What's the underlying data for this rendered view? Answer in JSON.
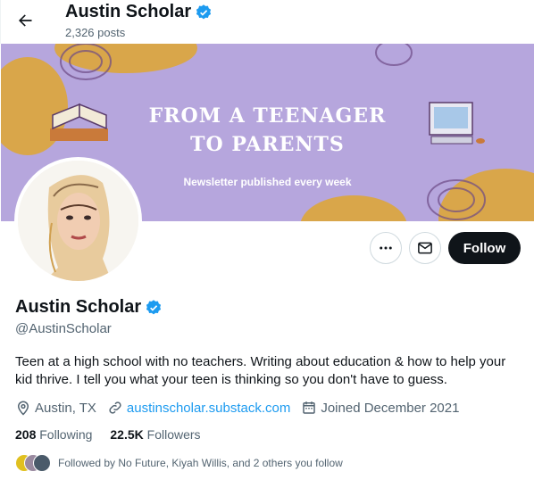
{
  "header": {
    "display_name": "Austin Scholar",
    "posts_count": "2,326 posts"
  },
  "banner": {
    "line1": "FROM A TEENAGER",
    "line2": "TO PARENTS",
    "subtitle": "Newsletter published every week"
  },
  "actions": {
    "follow_label": "Follow"
  },
  "profile": {
    "display_name": "Austin Scholar",
    "handle": "@AustinScholar",
    "bio": "Teen at a high school with no teachers. Writing about education & how to help your kid thrive. I tell you what your teen is thinking so you don't have to guess.",
    "location": "Austin, TX",
    "website": "austinscholar.substack.com",
    "joined": "Joined December 2021"
  },
  "stats": {
    "following_count": "208",
    "following_label": "Following",
    "followers_count": "22.5K",
    "followers_label": "Followers"
  },
  "followed_by": "Followed by No Future, Kiyah Willis, and 2 others you follow",
  "icons": [
    "back-arrow-icon",
    "verified-icon",
    "more-icon",
    "mail-icon",
    "location-icon",
    "link-icon",
    "calendar-icon"
  ],
  "colors": {
    "verified": "#1d9bf0",
    "banner": "#b6a6dd",
    "accent_orange": "#d9a64a",
    "link": "#1d9bf0"
  }
}
